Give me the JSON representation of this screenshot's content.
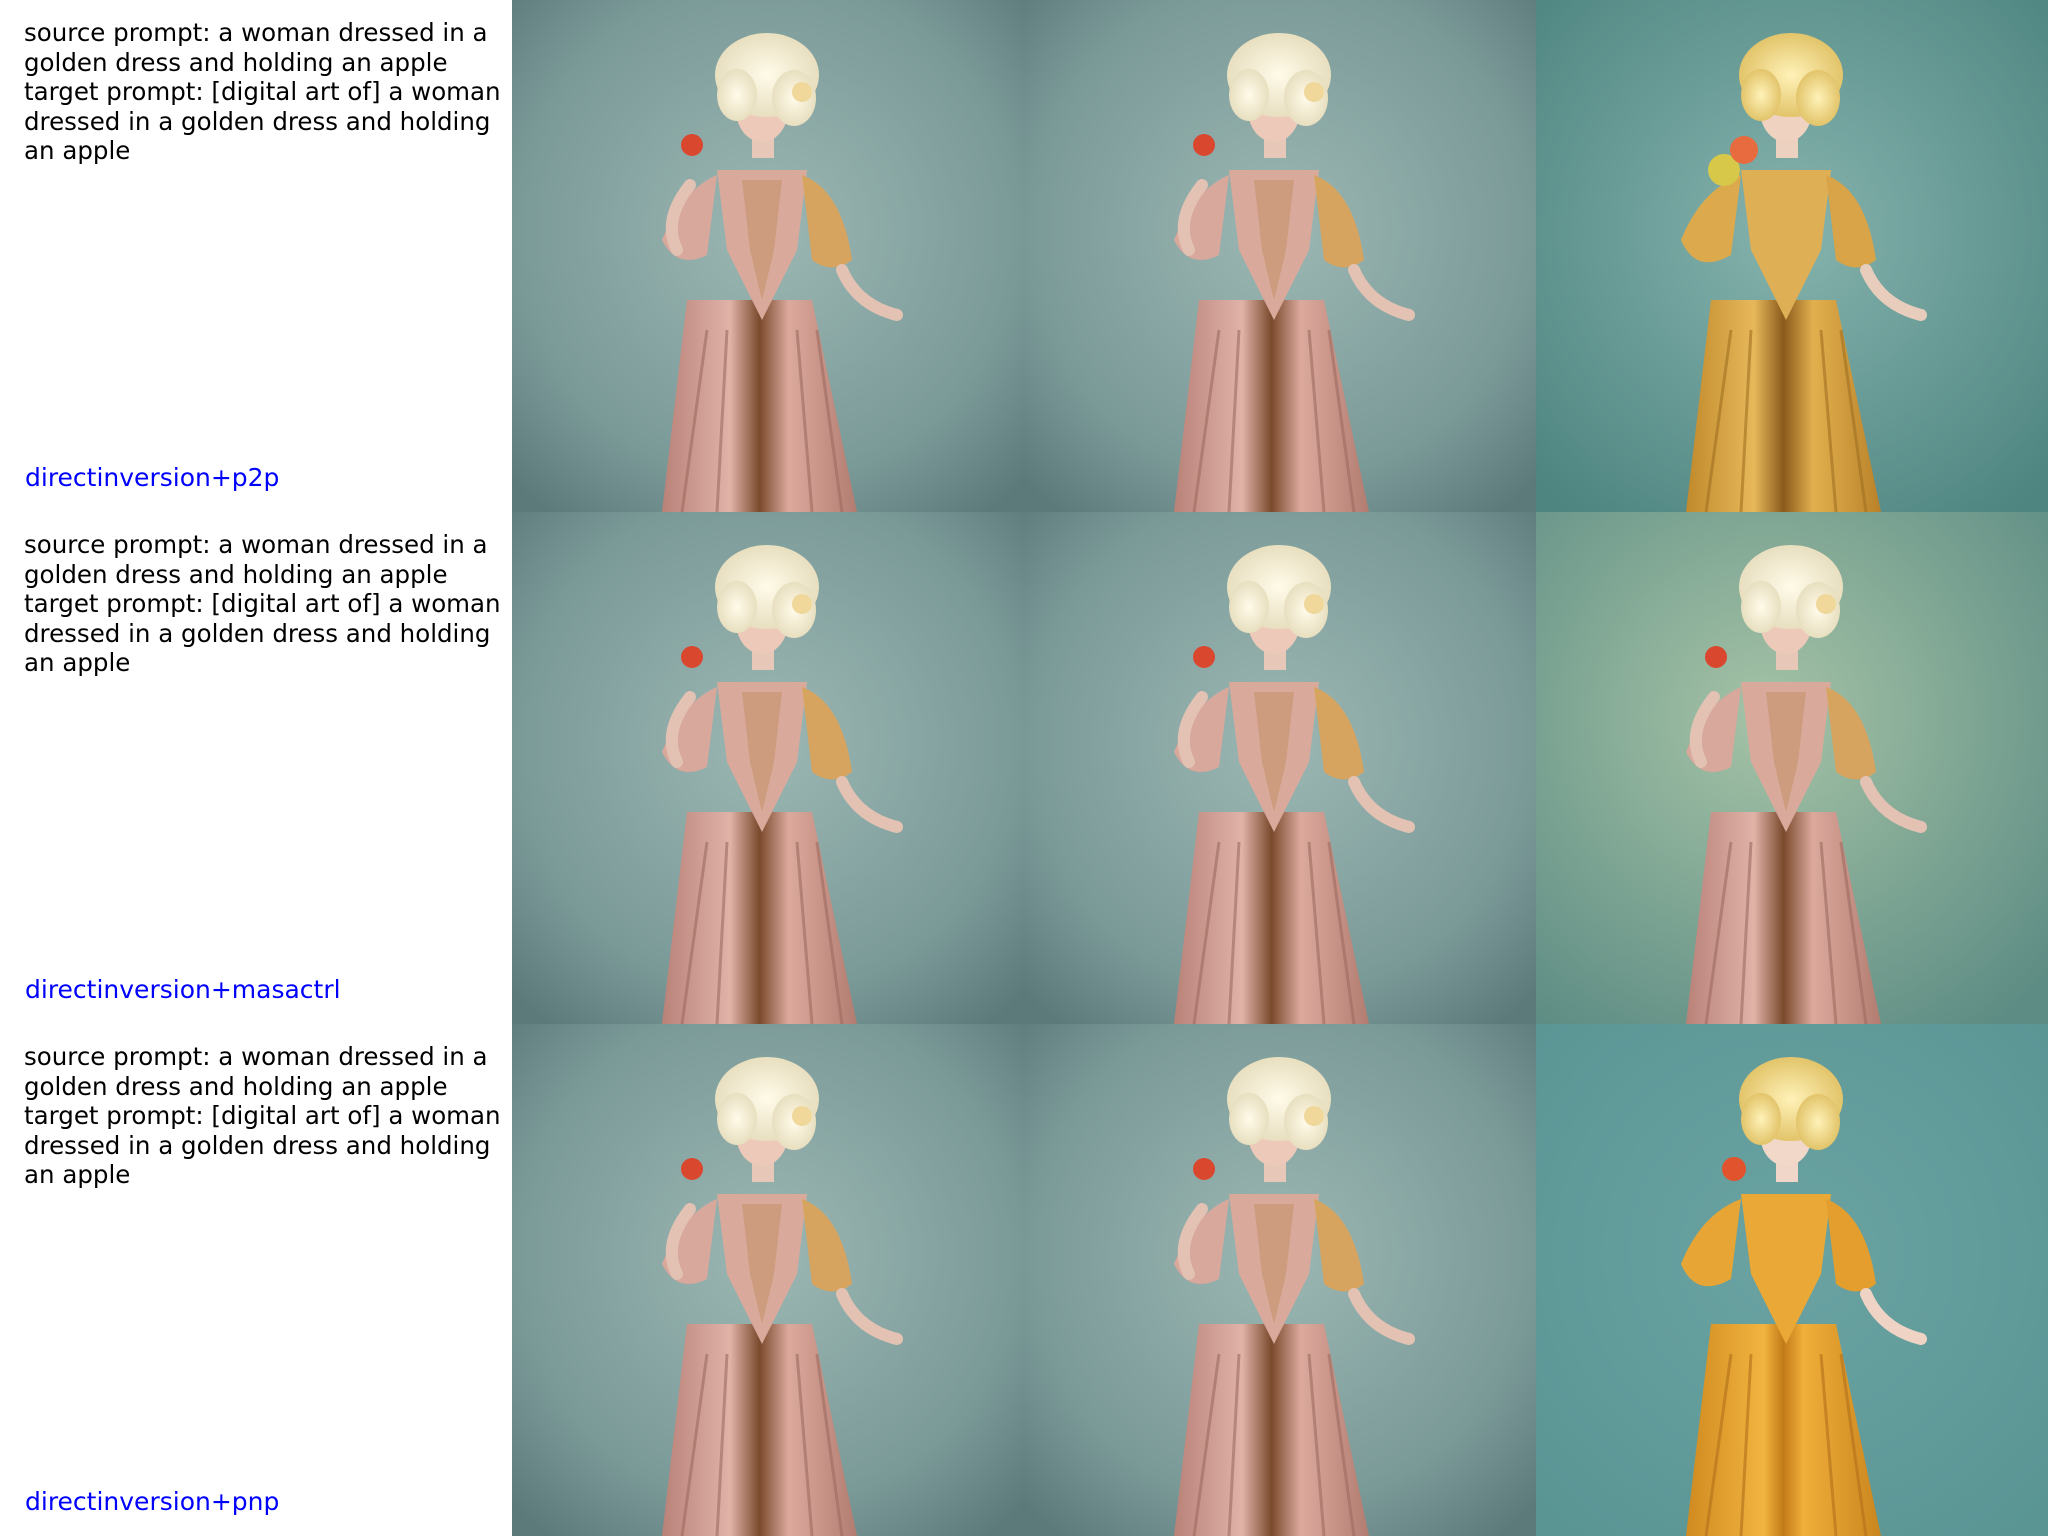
{
  "rows": [
    {
      "source_prompt": "source prompt: a woman dressed in a\ngolden dress and holding an apple",
      "target_prompt": "target prompt: [digital art of] a woman\ndressed in a golden dress and holding\nan apple",
      "method": "directinversion+p2p",
      "images": [
        "source-photo",
        "reconstruction",
        "edited-result"
      ]
    },
    {
      "source_prompt": "source prompt: a woman dressed in a\ngolden dress and holding an apple",
      "target_prompt": "target prompt: [digital art of] a woman\ndressed in a golden dress and holding\nan apple",
      "method": "directinversion+masactrl",
      "images": [
        "source-photo",
        "reconstruction",
        "edited-result"
      ]
    },
    {
      "source_prompt": "source prompt: a woman dressed in a\ngolden dress and holding an apple",
      "target_prompt": "target prompt: [digital art of] a woman\ndressed in a golden dress and holding\nan apple",
      "method": "directinversion+pnp",
      "images": [
        "source-photo",
        "reconstruction",
        "edited-result"
      ]
    }
  ],
  "colors": {
    "prompt_text": "#000000",
    "method_label": "#0000ff",
    "background_photo": "#7f9e9c",
    "background_edit_p2p": "#5f9590",
    "background_edit_masactrl": "#7fa590",
    "background_edit_pnp": "#5f9a9a",
    "dress_pink": "#d6a39a",
    "dress_gold": "#d9a640"
  }
}
